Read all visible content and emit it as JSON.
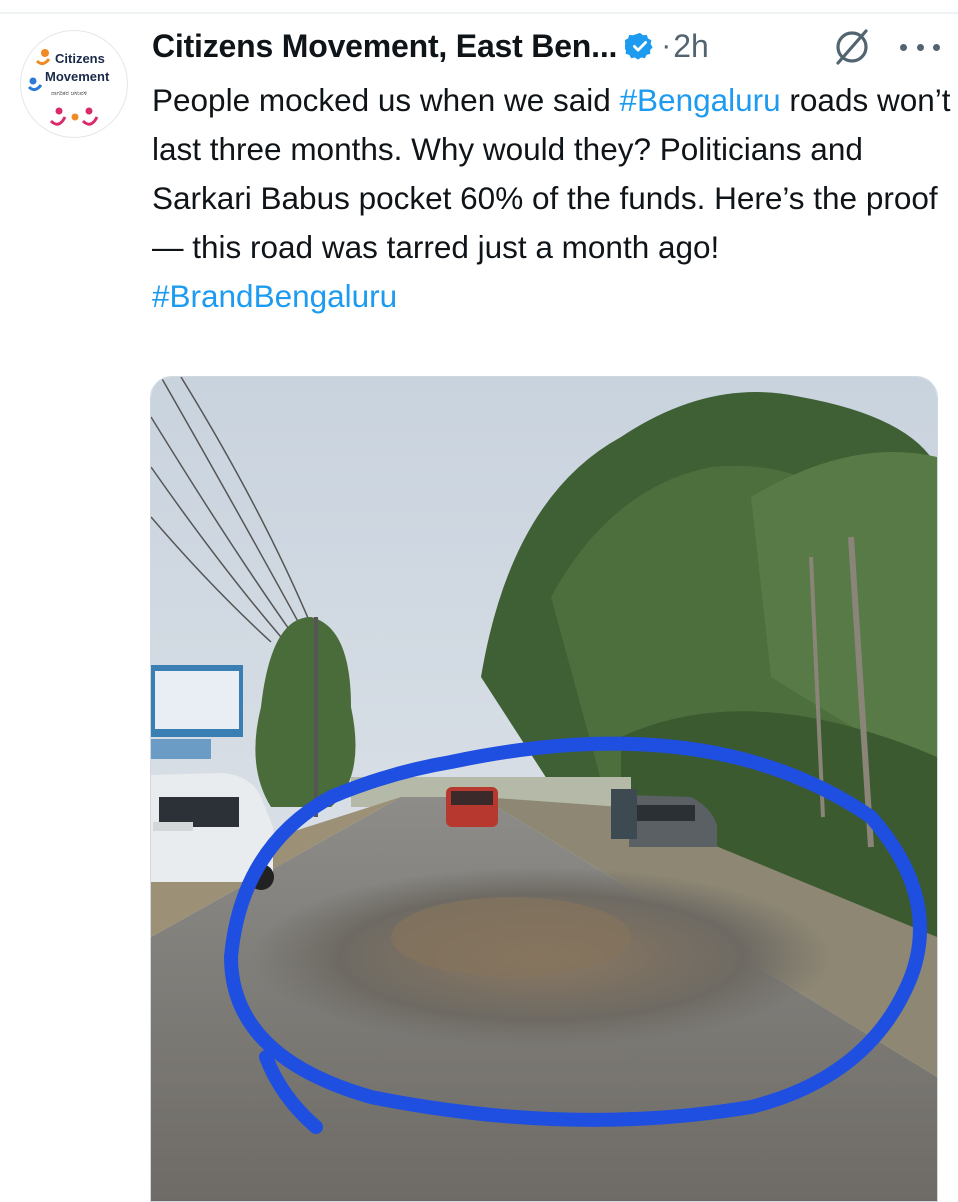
{
  "account": {
    "display_name": "Citizens Movement, East Ben...",
    "verified_icon": "verified-badge-icon",
    "separator": "·",
    "time": "2h",
    "avatar_line1": "Citizens",
    "avatar_line2": "Movement",
    "avatar_line3": "ನಾಗರಿಕರ ಚಳುವಳಿ"
  },
  "actions": {
    "grok_icon": "slash-circle-icon",
    "more_icon": "more-dots-icon"
  },
  "tweet": {
    "text_part1": "People mocked us when we said ",
    "hashtag1": "#Bengaluru",
    "text_part2": " roads won’t last three months. Why would they? Politicians and Sarkari Babus pocket 60% of the funds. Here’s the proof — this road was tarred just a month ago!",
    "hashtag2": "#BrandBengaluru"
  },
  "media": {
    "image_icon": "road-photo"
  },
  "colors": {
    "link": "#1d9bf0",
    "text": "#0f1419",
    "muted": "#536471",
    "annotation_circle": "#1f4fe0"
  }
}
